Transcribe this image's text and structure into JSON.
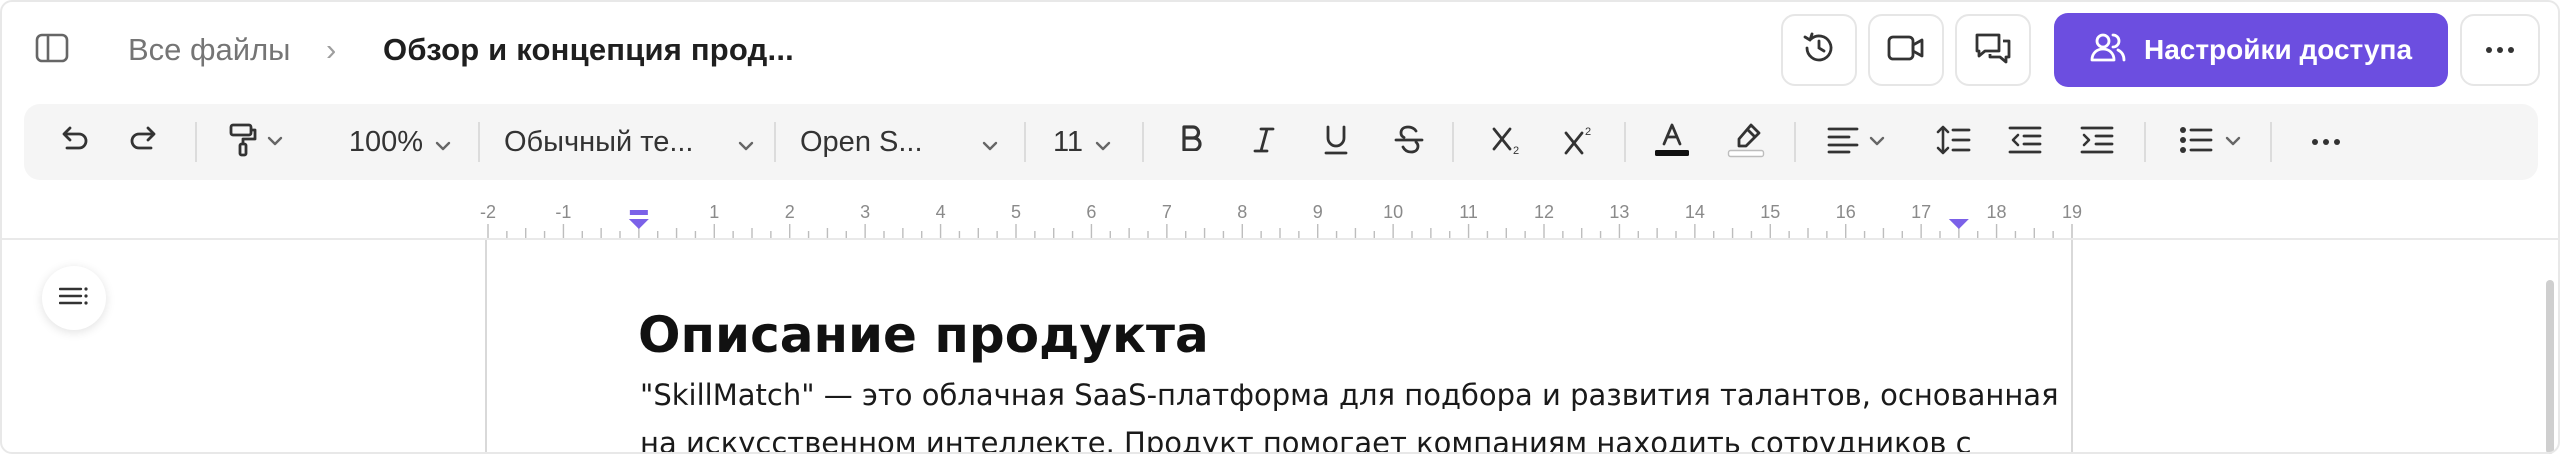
{
  "header": {
    "breadcrumb_root": "Все файлы",
    "breadcrumb_separator": "›",
    "document_title": "Обзор и концепция прод...",
    "share_label": "Настройки доступа",
    "icons": [
      "sidebar-toggle-icon",
      "history-icon",
      "video-icon",
      "comments-icon",
      "users-icon",
      "more-icon"
    ]
  },
  "toolbar": {
    "zoom": "100%",
    "paragraph_style": "Обычный те...",
    "font_family": "Open S...",
    "font_size": "11",
    "font_color": "#111111",
    "highlight_color": "#ffffff",
    "icons": [
      "undo-icon",
      "redo-icon",
      "paint-format-icon",
      "bold-icon",
      "italic-icon",
      "underline-icon",
      "strikethrough-icon",
      "subscript-icon",
      "superscript-icon",
      "text-color-icon",
      "highlight-icon",
      "align-left-icon",
      "line-spacing-icon",
      "outdent-icon",
      "indent-icon",
      "bulleted-list-icon",
      "more-icon"
    ]
  },
  "ruler": {
    "labels": [
      "-2",
      "-1",
      "1",
      "2",
      "3",
      "4",
      "5",
      "6",
      "7",
      "8",
      "9",
      "10",
      "11",
      "12",
      "13",
      "14",
      "15",
      "16",
      "17",
      "18",
      "19"
    ],
    "accent": "#7b61e8"
  },
  "document": {
    "heading": "Описание продукта",
    "paragraph_lines": [
      "\"SkillMatch\" — это облачная SaaS-платформа для подбора и развития талантов, основанная",
      "на искусственном интеллекте. Продукт помогает компаниям находить сотрудников с"
    ]
  },
  "colors": {
    "brand": "#6c4ee0",
    "toolbar_bg": "#f5f5f5"
  }
}
